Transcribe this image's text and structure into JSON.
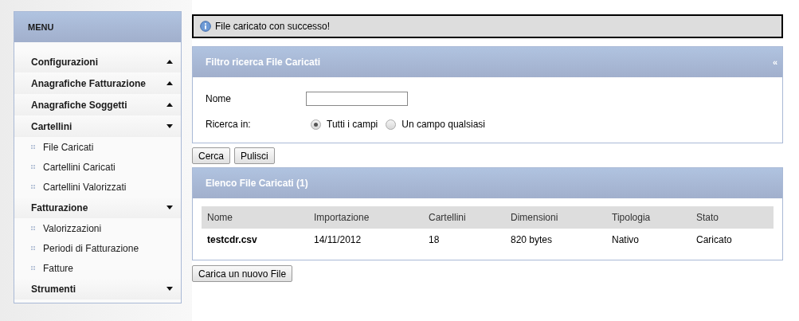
{
  "sidebar": {
    "title": "MENU",
    "sections": [
      {
        "label": "Configurazioni",
        "expanded": false
      },
      {
        "label": "Anagrafiche Fatturazione",
        "expanded": false
      },
      {
        "label": "Anagrafiche Soggetti",
        "expanded": false
      },
      {
        "label": "Cartellini",
        "expanded": true,
        "children": [
          {
            "label": "File Caricati"
          },
          {
            "label": "Cartellini Caricati"
          },
          {
            "label": "Cartellini Valorizzati"
          }
        ]
      },
      {
        "label": "Fatturazione",
        "expanded": true,
        "children": [
          {
            "label": "Valorizzazioni"
          },
          {
            "label": "Periodi di Fatturazione"
          },
          {
            "label": "Fatture"
          }
        ]
      },
      {
        "label": "Strumenti",
        "expanded": true
      }
    ]
  },
  "message": "File caricato con successo!",
  "filter": {
    "title": "Filtro ricerca File Caricati",
    "collapse": "«",
    "name_label": "Nome",
    "search_label": "Ricerca in:",
    "options": [
      {
        "label": "Tutti i campi",
        "selected": true
      },
      {
        "label": "Un campo qualsiasi",
        "selected": false
      }
    ],
    "buttons": [
      "Cerca",
      "Pulisci"
    ]
  },
  "list": {
    "title": "Elenco File Caricati (1)",
    "columns": [
      "Nome",
      "Importazione",
      "Cartellini",
      "Dimensioni",
      "Tipologia",
      "Stato"
    ],
    "rows": [
      [
        "testcdr.csv",
        "14/11/2012",
        "18",
        "820 bytes",
        "Nativo",
        "Caricato"
      ]
    ]
  },
  "upload_button": "Carica un nuovo File"
}
